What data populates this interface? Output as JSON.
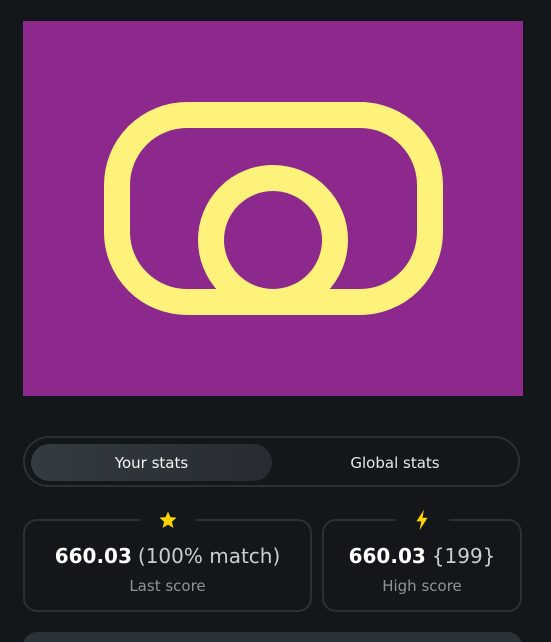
{
  "artwork": {
    "background": "#8d288c",
    "icon_color": "#fff27a",
    "icon": "camera-outline-icon"
  },
  "stats_toggle": {
    "your_stats_label": "Your stats",
    "global_stats_label": "Global stats",
    "selected": "Your stats"
  },
  "last_score": {
    "icon": "star-icon",
    "icon_color": "#ffd400",
    "value": "660.03",
    "extra": "(100% match)",
    "caption": "Last score"
  },
  "high_score": {
    "icon": "lightning-bolt-icon",
    "icon_color": "#ffd400",
    "value": "660.03",
    "extra": "{199}",
    "caption": "High score"
  }
}
